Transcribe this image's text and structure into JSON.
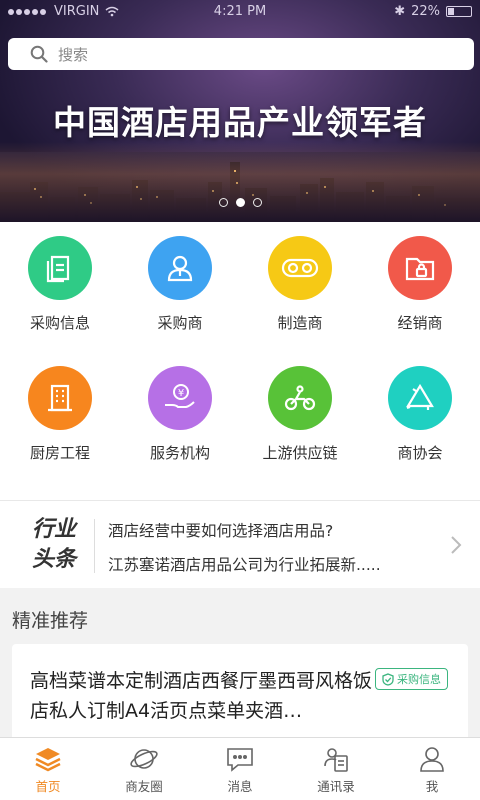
{
  "status_bar": {
    "carrier": "VIRGIN",
    "time": "4:21 PM",
    "battery": "22%"
  },
  "search": {
    "placeholder": "搜索"
  },
  "banner": {
    "slogan": "中国酒店用品产业领军者",
    "pages": 3,
    "active_page": 1
  },
  "categories": [
    {
      "label": "采购信息",
      "icon": "document-icon",
      "color": "#2fcb86"
    },
    {
      "label": "采购商",
      "icon": "person-icon",
      "color": "#3ea3f1"
    },
    {
      "label": "制造商",
      "icon": "gears-icon",
      "color": "#f6c915"
    },
    {
      "label": "经销商",
      "icon": "folder-lock-icon",
      "color": "#f1594a"
    },
    {
      "label": "厨房工程",
      "icon": "building-icon",
      "color": "#f7861e"
    },
    {
      "label": "服务机构",
      "icon": "yen-hand-icon",
      "color": "#b670e6"
    },
    {
      "label": "上游供应链",
      "icon": "bike-icon",
      "color": "#58c238"
    },
    {
      "label": "商协会",
      "icon": "recycle-icon",
      "color": "#1fd0c1"
    }
  ],
  "news": {
    "tag_line1": "行业",
    "tag_line2": "头条",
    "items": [
      "酒店经营中要如何选择酒店用品?",
      "江苏塞诺酒店用品公司为行业拓展新....."
    ]
  },
  "recommend": {
    "title": "精准推荐",
    "card": {
      "title": "高档菜谱本定制酒店西餐厅墨西哥风格饭店私人订制A4活页点菜单夹酒…",
      "badge": "采购信息"
    }
  },
  "tabbar": {
    "active": 0,
    "tabs": [
      {
        "label": "首页",
        "icon": "layers-icon"
      },
      {
        "label": "商友圈",
        "icon": "planet-icon"
      },
      {
        "label": "消息",
        "icon": "chat-icon"
      },
      {
        "label": "通讯录",
        "icon": "contacts-icon"
      },
      {
        "label": "我",
        "icon": "user-icon"
      }
    ]
  },
  "colors": {
    "accent": "#f08a24",
    "badge_green": "#3bb57f"
  }
}
